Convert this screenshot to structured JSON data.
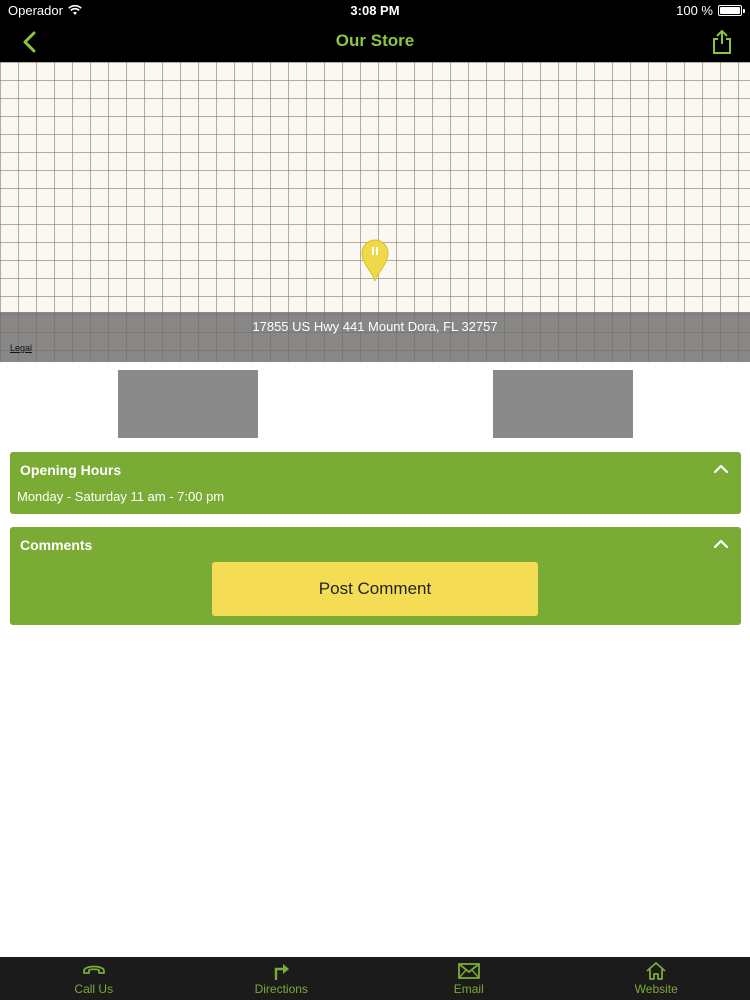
{
  "status": {
    "carrier": "Operador",
    "time": "3:08 PM",
    "battery": "100 %",
    "battery_level": 1.0
  },
  "nav": {
    "title": "Our Store"
  },
  "map": {
    "address": "17855 US Hwy 441 Mount Dora, FL 32757",
    "legal": "Legal"
  },
  "hours": {
    "title": "Opening Hours",
    "text": "Monday - Saturday 11 am - 7:00 pm"
  },
  "comments": {
    "title": "Comments",
    "button": "Post Comment"
  },
  "tabs": [
    {
      "label": "Call Us",
      "icon": "phone-icon"
    },
    {
      "label": "Directions",
      "icon": "directions-icon"
    },
    {
      "label": "Email",
      "icon": "email-icon"
    },
    {
      "label": "Website",
      "icon": "home-icon"
    }
  ],
  "colors": {
    "accent": "#7aab35",
    "title_green": "#8cc63f",
    "button_yellow": "#f5dc55",
    "bar": "#000000"
  }
}
